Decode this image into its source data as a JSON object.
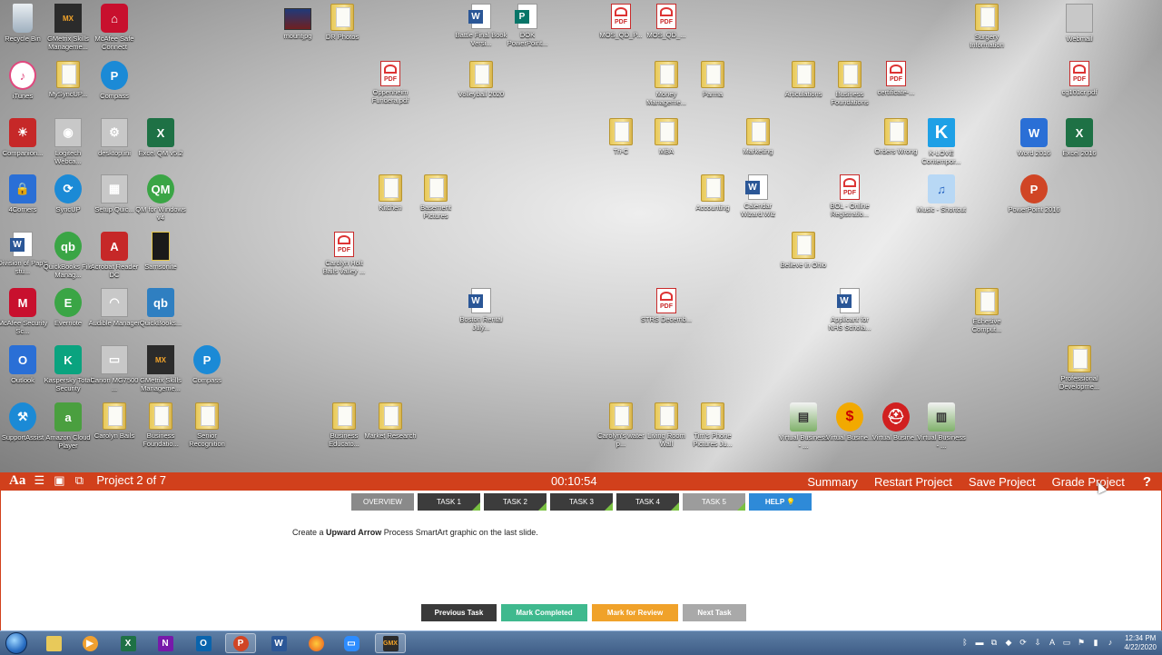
{
  "desktop_icons": [
    {
      "label": "Recycle Bin",
      "icon": "recycle-bin-icon",
      "style": "g-recycle",
      "glyph": ""
    },
    {
      "label": "GMetrix Skills Manageme...",
      "icon": "gmetrix-icon",
      "style": "g-gmetrix",
      "glyph": "MX"
    },
    {
      "label": "McAfee Safe Connect",
      "icon": "mcafee-safe-connect-icon",
      "style": "g-mcafee",
      "glyph": "⌂"
    },
    {
      "label": "mountjpg",
      "icon": "image-file-icon",
      "style": "g-photo",
      "glyph": ""
    },
    {
      "label": "DR Photos",
      "icon": "folder-icon",
      "style": "g-folder",
      "glyph": ""
    },
    {
      "label": "Battle Final Book Versi...",
      "icon": "word-document-icon",
      "style": "g-word",
      "glyph": ""
    },
    {
      "label": "DOK PowerPoint...",
      "icon": "publisher-document-icon",
      "style": "g-pub",
      "glyph": ""
    },
    {
      "label": "MOS_QD_P...",
      "icon": "pdf-file-icon",
      "style": "g-pdf",
      "glyph": "PDF"
    },
    {
      "label": "MOS_QD_...",
      "icon": "pdf-file-icon",
      "style": "g-pdf",
      "glyph": "PDF"
    },
    {
      "label": "Surgery Information",
      "icon": "folder-icon",
      "style": "g-folder",
      "glyph": ""
    },
    {
      "label": "Webmail",
      "icon": "document-icon",
      "style": "g-gray",
      "glyph": ""
    },
    {
      "label": "iTunes",
      "icon": "itunes-icon",
      "style": "g-itunes",
      "glyph": "♪"
    },
    {
      "label": "MySyncUP...",
      "icon": "folder-icon",
      "style": "g-folder",
      "glyph": ""
    },
    {
      "label": "Compass",
      "icon": "compass-icon",
      "style": "g-round-blue",
      "glyph": "P"
    },
    {
      "label": "Oppenheim Fundera.pdf",
      "icon": "pdf-file-icon",
      "style": "g-pdf",
      "glyph": "PDF"
    },
    {
      "label": "Volleyball 2020",
      "icon": "folder-icon",
      "style": "g-folder",
      "glyph": ""
    },
    {
      "label": "Money Manageme...",
      "icon": "folder-icon",
      "style": "g-folder",
      "glyph": ""
    },
    {
      "label": "Parma",
      "icon": "folder-icon",
      "style": "g-folder",
      "glyph": ""
    },
    {
      "label": "Articulations",
      "icon": "folder-icon",
      "style": "g-folder",
      "glyph": ""
    },
    {
      "label": "Business Foundations",
      "icon": "folder-icon",
      "style": "g-folder",
      "glyph": ""
    },
    {
      "label": "certificate-...",
      "icon": "pdf-file-icon",
      "style": "g-pdf",
      "glyph": "PDF"
    },
    {
      "label": "cg101cr.pdf",
      "icon": "pdf-file-icon",
      "style": "g-pdf",
      "glyph": "PDF"
    },
    {
      "label": "Companion...",
      "icon": "companion-icon",
      "style": "g-red",
      "glyph": "☀"
    },
    {
      "label": "Logitech Webca...",
      "icon": "webcam-icon",
      "style": "g-gray",
      "glyph": "◉"
    },
    {
      "label": "desktop.ini",
      "icon": "settings-file-icon",
      "style": "g-gray",
      "glyph": "⚙"
    },
    {
      "label": "Excel QM v5.2",
      "icon": "excel-qm-icon",
      "style": "g-excel",
      "glyph": "X"
    },
    {
      "label": "Tri-C",
      "icon": "folder-icon",
      "style": "g-folder",
      "glyph": ""
    },
    {
      "label": "MBA",
      "icon": "folder-icon",
      "style": "g-folder",
      "glyph": ""
    },
    {
      "label": "Marketing",
      "icon": "folder-icon",
      "style": "g-folder",
      "glyph": ""
    },
    {
      "label": "Orders Wrong",
      "icon": "folder-icon",
      "style": "g-folder",
      "glyph": ""
    },
    {
      "label": "K-LOVE Contempor...",
      "icon": "k-love-icon",
      "style": "g-k",
      "glyph": "K"
    },
    {
      "label": "Word 2016",
      "icon": "word-icon",
      "style": "g-blue",
      "glyph": "W"
    },
    {
      "label": "Excel 2016",
      "icon": "excel-icon",
      "style": "g-excel",
      "glyph": "X"
    },
    {
      "label": "4Corners",
      "icon": "lock-icon",
      "style": "g-blue",
      "glyph": "🔒"
    },
    {
      "label": "SyncUP",
      "icon": "sync-icon",
      "style": "g-round-blue",
      "glyph": "⟳"
    },
    {
      "label": "Setup Quic...",
      "icon": "setup-icon",
      "style": "g-gray",
      "glyph": "▦"
    },
    {
      "label": "QM for Windows v4",
      "icon": "qm-icon",
      "style": "g-green",
      "glyph": "QM"
    },
    {
      "label": "Kitchen",
      "icon": "folder-icon",
      "style": "g-folder",
      "glyph": ""
    },
    {
      "label": "Basement Pictures",
      "icon": "folder-icon",
      "style": "g-folder",
      "glyph": ""
    },
    {
      "label": "Accounting",
      "icon": "folder-icon",
      "style": "g-folder",
      "glyph": ""
    },
    {
      "label": "Calendar Wizard.Wiz",
      "icon": "word-document-icon",
      "style": "g-word",
      "glyph": ""
    },
    {
      "label": "BOL - Online Registratio...",
      "icon": "pdf-file-icon",
      "style": "g-pdf",
      "glyph": "PDF"
    },
    {
      "label": "Music - Shortcut",
      "icon": "music-icon",
      "style": "g-music",
      "glyph": "♫"
    },
    {
      "label": "PowerPoint 2016",
      "icon": "powerpoint-icon",
      "style": "g-ppt",
      "glyph": "P"
    },
    {
      "label": "Division of Pap's stu...",
      "icon": "word-document-icon",
      "style": "g-word",
      "glyph": ""
    },
    {
      "label": "QuickBooks File Manag...",
      "icon": "quickbooks-icon",
      "style": "g-green",
      "glyph": "qb"
    },
    {
      "label": "Acrobat Reader DC",
      "icon": "acrobat-icon",
      "style": "g-red",
      "glyph": "A"
    },
    {
      "label": "Samsonite",
      "icon": "samsonite-icon",
      "style": "g-samsonite",
      "glyph": ""
    },
    {
      "label": "Carolyn Holt Bails Valley ...",
      "icon": "pdf-file-icon",
      "style": "g-pdf",
      "glyph": "PDF"
    },
    {
      "label": "Believe in Ohio",
      "icon": "folder-icon",
      "style": "g-folder",
      "glyph": ""
    },
    {
      "label": "McAfee Security Sc...",
      "icon": "mcafee-icon",
      "style": "g-mcafee",
      "glyph": "M"
    },
    {
      "label": "Evernote",
      "icon": "evernote-icon",
      "style": "g-green",
      "glyph": "E"
    },
    {
      "label": "Audible Manager",
      "icon": "audible-icon",
      "style": "g-gray",
      "glyph": "◠"
    },
    {
      "label": "QuickBooks...",
      "icon": "quickbooks-icon",
      "style": "g-quick",
      "glyph": "qb"
    },
    {
      "label": "Boston Rental July...",
      "icon": "word-document-icon",
      "style": "g-word",
      "glyph": ""
    },
    {
      "label": "STRS Decemb...",
      "icon": "pdf-file-icon",
      "style": "g-pdf",
      "glyph": "PDF"
    },
    {
      "label": "Applicant for NHS Schola...",
      "icon": "word-document-icon",
      "style": "g-word",
      "glyph": ""
    },
    {
      "label": "Edhesive Comput...",
      "icon": "folder-icon",
      "style": "g-folder",
      "glyph": ""
    },
    {
      "label": "Outlook",
      "icon": "outlook-icon",
      "style": "g-blue",
      "glyph": "O"
    },
    {
      "label": "Kaspersky Total Security",
      "icon": "kaspersky-icon",
      "style": "g-kaspersky",
      "glyph": "K"
    },
    {
      "label": "Canon MG7500 ...",
      "icon": "printer-icon",
      "style": "g-gray",
      "glyph": "▭"
    },
    {
      "label": "GMetrix Skills Manageme...",
      "icon": "gmetrix-icon",
      "style": "g-gmetrix",
      "glyph": "MX"
    },
    {
      "label": "Compass",
      "icon": "compass-icon",
      "style": "g-round-blue",
      "glyph": "P"
    },
    {
      "label": "Professional Developme...",
      "icon": "folder-icon",
      "style": "g-folder",
      "glyph": ""
    },
    {
      "label": "SupportAssist",
      "icon": "support-assist-icon",
      "style": "g-round-blue",
      "glyph": "⚒"
    },
    {
      "label": "Amazon Cloud Player",
      "icon": "amazon-icon",
      "style": "g-amazon",
      "glyph": "a"
    },
    {
      "label": "Carolyn Bails",
      "icon": "folder-icon",
      "style": "g-folder",
      "glyph": ""
    },
    {
      "label": "Business Foundatio...",
      "icon": "folder-icon",
      "style": "g-folder",
      "glyph": ""
    },
    {
      "label": "Senior Recognition",
      "icon": "folder-icon",
      "style": "g-folder",
      "glyph": ""
    },
    {
      "label": "Business Educato...",
      "icon": "folder-icon",
      "style": "g-folder",
      "glyph": ""
    },
    {
      "label": "Market Research",
      "icon": "folder-icon",
      "style": "g-folder",
      "glyph": ""
    },
    {
      "label": "Carolyn's water p...",
      "icon": "folder-icon",
      "style": "g-folder",
      "glyph": ""
    },
    {
      "label": "Living Room Wall",
      "icon": "folder-icon",
      "style": "g-folder",
      "glyph": ""
    },
    {
      "label": "Tim's Phone Pictures Ju...",
      "icon": "folder-icon",
      "style": "g-folder",
      "glyph": ""
    },
    {
      "label": "Virtual Business - ...",
      "icon": "virtual-business-icon",
      "style": "g-virtual",
      "glyph": "▤"
    },
    {
      "label": "Virtual Busine...",
      "icon": "virtual-business-icon",
      "style": "g-yellowq",
      "glyph": "$"
    },
    {
      "label": "Virtual Busine...",
      "icon": "virtual-business-icon",
      "style": "g-redq",
      "glyph": "⛑"
    },
    {
      "label": "Virtual Business - ...",
      "icon": "virtual-business-icon",
      "style": "g-virtual",
      "glyph": "▥"
    }
  ],
  "toolbar": {
    "project_label": "Project 2 of 7",
    "timer": "00:10:54",
    "summary": "Summary",
    "restart": "Restart Project",
    "save": "Save Project",
    "grade": "Grade Project",
    "help_glyph": "?"
  },
  "tabs": {
    "overview": "OVERVIEW",
    "task1": "TASK 1",
    "task2": "TASK 2",
    "task3": "TASK 3",
    "task4": "TASK 4",
    "task5": "TASK 5",
    "help": "HELP 💡"
  },
  "instruction": {
    "prefix": "Create a ",
    "bold": "Upward Arrow",
    "suffix": " Process SmartArt graphic on the last slide."
  },
  "actions": {
    "previous": "Previous Task",
    "completed": "Mark Completed",
    "review": "Mark for Review",
    "next": "Next Task"
  },
  "taskbar": {
    "clock_time": "12:34 PM",
    "clock_date": "4/22/2020"
  },
  "colors": {
    "gmetrix_bar": "#d1401c",
    "help_tab": "#2e8ad8",
    "mark_completed": "#3fb98e",
    "mark_review": "#f0a22a"
  }
}
